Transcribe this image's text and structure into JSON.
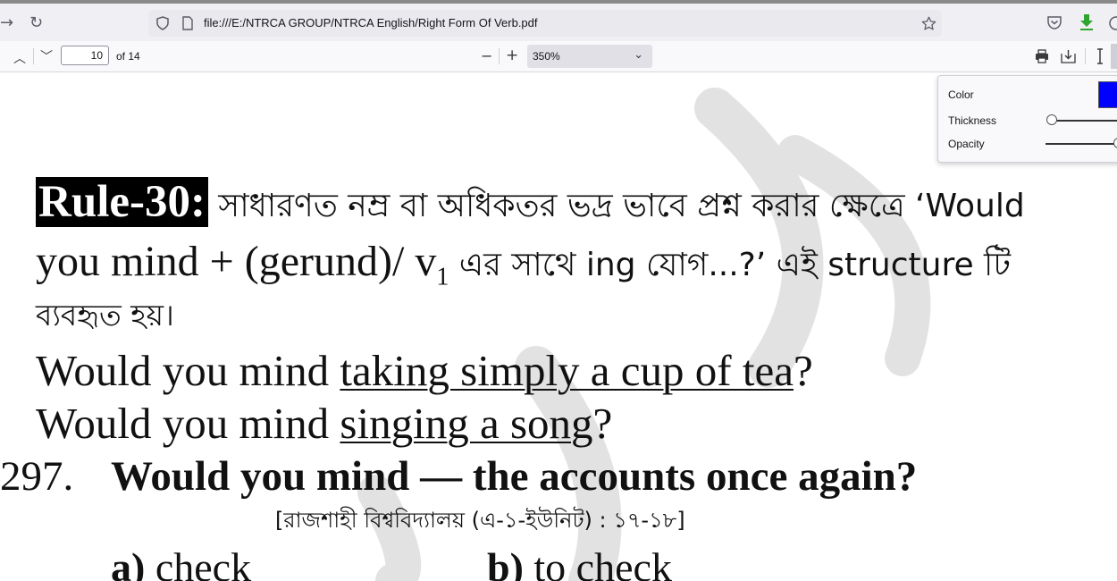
{
  "browser": {
    "url": "file:///E:/NTRCA GROUP/NTRCA English/Right Form Of Verb.pdf"
  },
  "pdf_toolbar": {
    "current_page": "10",
    "page_count": "of 14",
    "zoom": "350%"
  },
  "ink_panel": {
    "color_label": "Color",
    "thickness_label": "Thickness",
    "opacity_label": "Opacity",
    "color_value": "#0000ff"
  },
  "document": {
    "rule_label": "Rule-30:",
    "rule_line1_rest": " সাধারণত নম্র বা অধিকতর ভদ্র ভাবে প্রশ্ন করার ক্ষেত্রে ‘Would",
    "rule_line2_a": "you mind + (gerund)/ v",
    "rule_line2_sub": "1",
    "rule_line2_b": " এর সাথে ing যোগ...?’ এই structure টি",
    "rule_line3": "ব্যবহৃত হয়।",
    "ex1_start": "Would you mind ",
    "ex1_underlined": "taking simply a cup of tea",
    "ex1_end": "?",
    "ex2_start": "Would you mind ",
    "ex2_underlined": "singing a song",
    "ex2_end": "?",
    "q_number": "297.",
    "q_text": "Would you mind — the accounts once again?",
    "q_source": "[রাজশাহী বিশ্ববিদ্যালয় (এ-১-ইউনিট) : ১৭-১৮]",
    "opt_a_letter": "a)",
    "opt_a_text": " check",
    "opt_b_letter": "b)",
    "opt_b_text": " to check"
  }
}
